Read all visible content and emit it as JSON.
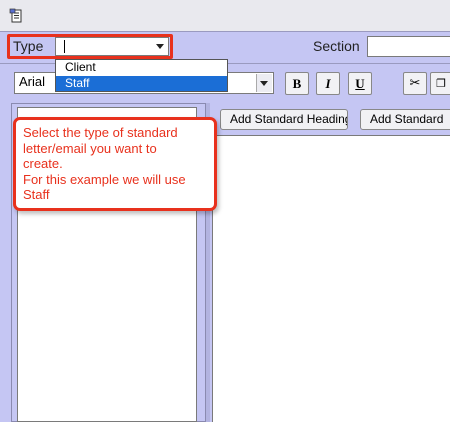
{
  "toolbar": {
    "type_label": "Type",
    "type_value": "",
    "section_label": "Section",
    "section_value": "",
    "font_value": "Arial",
    "bold_label": "B",
    "italic_label": "I",
    "underline_label": "U",
    "cut_icon": "scissors-icon",
    "copy_icon": "copy-icon"
  },
  "type_dropdown": {
    "options": [
      "Client",
      "Staff"
    ],
    "selected": "Staff"
  },
  "buttons": {
    "add_heading": "Add Standard Heading",
    "add_standard": "Add Standard"
  },
  "callout": {
    "lines": [
      "Select the type of standard",
      "letter/email you want to",
      "create.",
      "For this example we will use",
      "Staff"
    ]
  },
  "colors": {
    "panel_bg": "#c5c6f3",
    "highlight_red": "#e8311d",
    "selection_blue": "#1b6ed6"
  }
}
